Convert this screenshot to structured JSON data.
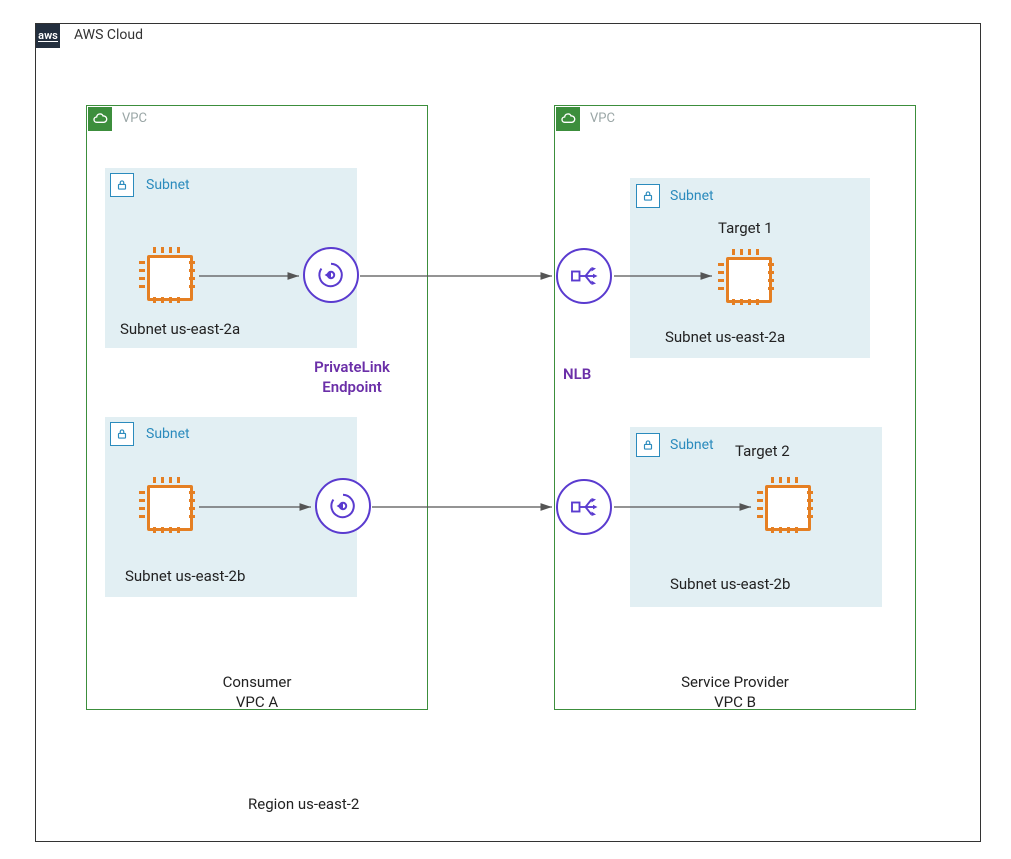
{
  "cloud": {
    "label": "AWS Cloud"
  },
  "region": {
    "label": "Region us-east-2"
  },
  "vpcA": {
    "badge": "VPC",
    "caption_line1": "Consumer",
    "caption_line2": "VPC A",
    "subnets": {
      "top": {
        "label": "Subnet",
        "zone": "Subnet us-east-2a"
      },
      "bottom": {
        "label": "Subnet",
        "zone": "Subnet us-east-2b"
      }
    },
    "endpoint_label_line1": "PrivateLink",
    "endpoint_label_line2": "Endpoint"
  },
  "vpcB": {
    "badge": "VPC",
    "caption_line1": "Service Provider",
    "caption_line2": "VPC B",
    "subnets": {
      "top": {
        "label": "Subnet",
        "zone": "Subnet us-east-2a",
        "target": "Target 1"
      },
      "bottom": {
        "label": "Subnet",
        "zone": "Subnet us-east-2b",
        "target": "Target 2"
      }
    },
    "nlb_label": "NLB"
  }
}
